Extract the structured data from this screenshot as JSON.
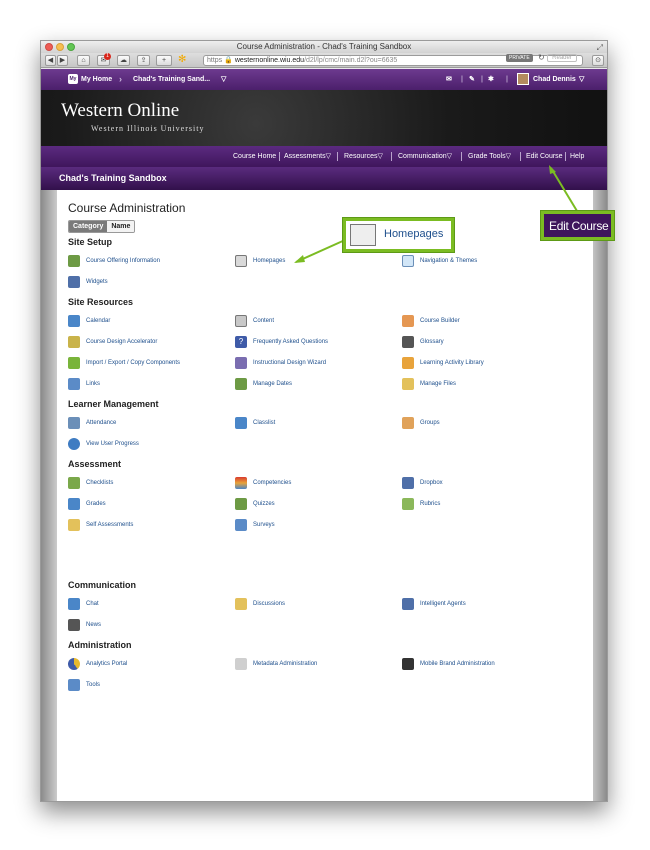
{
  "window": {
    "title": "Course Administration - Chad's Training Sandbox"
  },
  "browser": {
    "url_scheme": "https",
    "url_host": "westernonline.wiu.edu",
    "url_path": "/d2l/lp/cmc/main.d2l?ou=6635",
    "private_label": "PRIVATE",
    "reader_label": "Reader",
    "notification_count": "1"
  },
  "topnav": {
    "home_badge": "My",
    "home_label": "My Home",
    "course_label": "Chad's Training Sand...",
    "user_name": "Chad Dennis"
  },
  "banner": {
    "title": "Western Online",
    "subtitle": "Western Illinois University"
  },
  "coursenav": {
    "items": [
      "Course Home",
      "Assessments",
      "Resources",
      "Communication",
      "Grade Tools",
      "Edit Course",
      "Help"
    ]
  },
  "course_bar": {
    "title": "Chad's Training Sandbox"
  },
  "page": {
    "title": "Course Administration",
    "toggle": [
      "Category",
      "Name"
    ],
    "sections": [
      {
        "title": "Site Setup",
        "tools": [
          "Course Offering Information",
          "Homepages",
          "Navigation & Themes",
          "Widgets"
        ]
      },
      {
        "title": "Site Resources",
        "tools": [
          "Calendar",
          "Content",
          "Course Builder",
          "Course Design Accelerator",
          "Frequently Asked Questions",
          "Glossary",
          "Import / Export / Copy Components",
          "Instructional Design Wizard",
          "Learning Activity Library",
          "Links",
          "Manage Dates",
          "Manage Files"
        ]
      },
      {
        "title": "Learner Management",
        "tools": [
          "Attendance",
          "Classlist",
          "Groups",
          "View User Progress"
        ]
      },
      {
        "title": "Assessment",
        "tools": [
          "Checklists",
          "Competencies",
          "Dropbox",
          "Grades",
          "Quizzes",
          "Rubrics",
          "Self Assessments",
          "Surveys"
        ]
      },
      {
        "title": "Communication",
        "tools": [
          "Chat",
          "Discussions",
          "Intelligent Agents",
          "News"
        ]
      },
      {
        "title": "Administration",
        "tools": [
          "Analytics Portal",
          "Metadata Administration",
          "Mobile Brand Administration",
          "Tools"
        ]
      }
    ]
  },
  "callouts": {
    "homepages": "Homepages",
    "edit_course": "Edit Course"
  },
  "colors": {
    "purple_dark": "#3f165c",
    "link_blue": "#1e4f8c",
    "callout_green": "#7bbc22"
  }
}
